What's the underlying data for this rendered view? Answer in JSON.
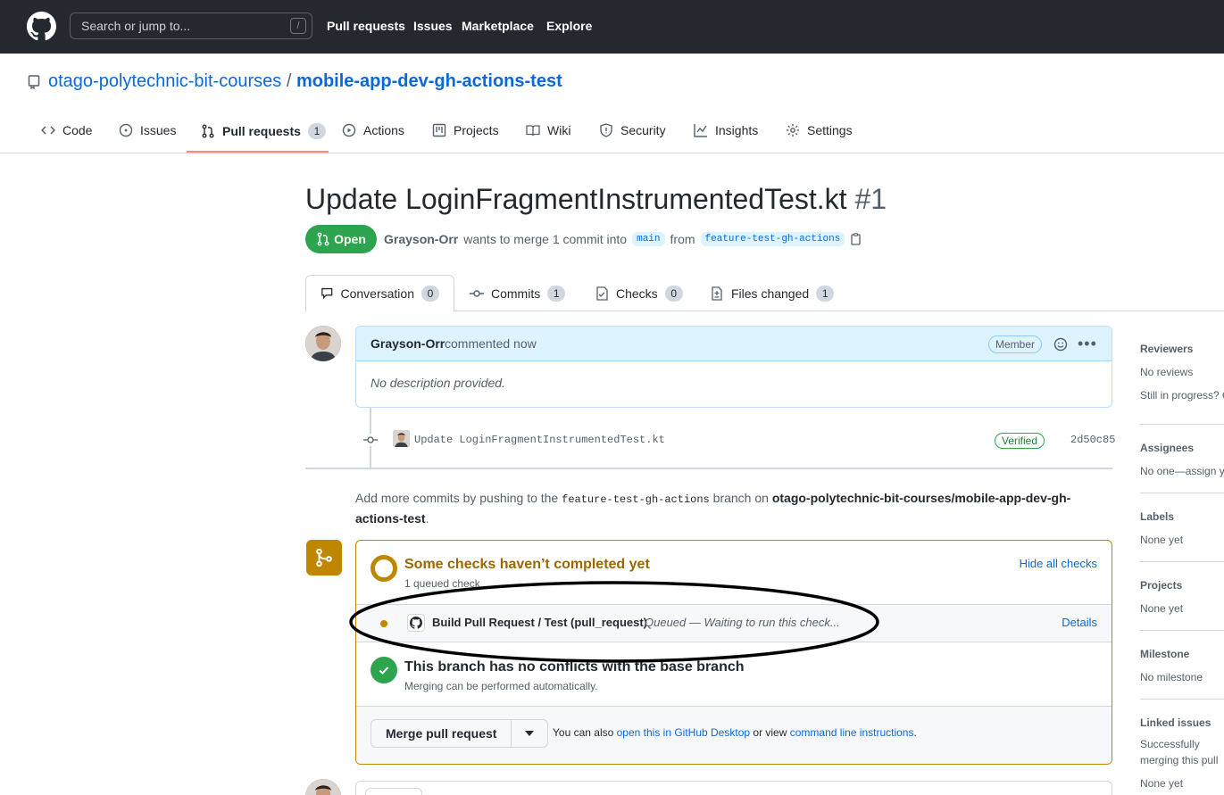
{
  "header": {
    "search_placeholder": "Search or jump to...",
    "search_shortcut": "/",
    "nav": [
      "Pull requests",
      "Issues",
      "Marketplace",
      "Explore"
    ]
  },
  "repo": {
    "owner": "otago-polytechnic-bit-courses",
    "separator": "/",
    "name": "mobile-app-dev-gh-actions-test",
    "tabs": [
      {
        "label": "Code",
        "icon": "code-icon"
      },
      {
        "label": "Issues",
        "icon": "issue-icon"
      },
      {
        "label": "Pull requests",
        "icon": "pull-request-icon",
        "count": "1",
        "selected": true
      },
      {
        "label": "Actions",
        "icon": "play-icon"
      },
      {
        "label": "Projects",
        "icon": "project-icon"
      },
      {
        "label": "Wiki",
        "icon": "book-icon"
      },
      {
        "label": "Security",
        "icon": "shield-icon"
      },
      {
        "label": "Insights",
        "icon": "graph-icon"
      },
      {
        "label": "Settings",
        "icon": "gear-icon"
      }
    ]
  },
  "pr": {
    "title": "Update LoginFragmentInstrumentedTest.kt",
    "number": "#1",
    "state": "Open",
    "author": "Grayson-Orr",
    "merge_text": "wants to merge 1 commit into",
    "base": "main",
    "from": "from",
    "head": "feature-test-gh-actions",
    "tabs": [
      {
        "label": "Conversation",
        "count": "0",
        "icon": "comment-icon"
      },
      {
        "label": "Commits",
        "count": "1",
        "icon": "commit-icon"
      },
      {
        "label": "Checks",
        "count": "0",
        "icon": "checklist-icon"
      },
      {
        "label": "Files changed",
        "count": "1",
        "icon": "file-diff-icon"
      }
    ]
  },
  "comment": {
    "author": "Grayson-Orr",
    "when": "commented now",
    "role": "Member",
    "body": "No description provided."
  },
  "commit": {
    "message": "Update LoginFragmentInstrumentedTest.kt",
    "badge": "Verified",
    "sha": "2d50c85"
  },
  "push_note": {
    "prefix": "Add more commits by pushing to the",
    "branch": "feature-test-gh-actions",
    "middle": "branch on",
    "repo": "otago-polytechnic-bit-courses/mobile-app-dev-gh-actions-test",
    "suffix": "."
  },
  "merge_box": {
    "checks_title": "Some checks haven’t completed yet",
    "checks_sub": "1 queued check",
    "hide_checks": "Hide all checks",
    "check_name": "Build Pull Request / Test (pull_request)",
    "check_status": "Queued — Waiting to run this check...",
    "details": "Details",
    "conflict_title": "This branch has no conflicts with the base branch",
    "conflict_sub": "Merging can be performed automatically.",
    "merge_button": "Merge pull request",
    "also_prefix": "You can also",
    "desktop_link": "open this in GitHub Desktop",
    "or_view": "or view",
    "cli_link": "command line instructions",
    "period": "."
  },
  "sidebar": [
    {
      "heading": "Reviewers",
      "lines": [
        "No reviews",
        "Still in progress? Convert to draft"
      ]
    },
    {
      "heading": "Assignees",
      "lines": [
        "No one—assign yourself"
      ]
    },
    {
      "heading": "Labels",
      "lines": [
        "None yet"
      ]
    },
    {
      "heading": "Projects",
      "lines": [
        "None yet"
      ]
    },
    {
      "heading": "Milestone",
      "lines": [
        "No milestone"
      ]
    },
    {
      "heading": "Linked issues",
      "lines": [
        "Successfully merging this pull request may close these issues.",
        "None yet"
      ]
    }
  ],
  "colors": {
    "header_bg": "#24292f",
    "open_green": "#2da44e",
    "pending_yellow": "#bf8700",
    "link_blue": "#0969da",
    "tab_underline": "#fd8c73"
  }
}
